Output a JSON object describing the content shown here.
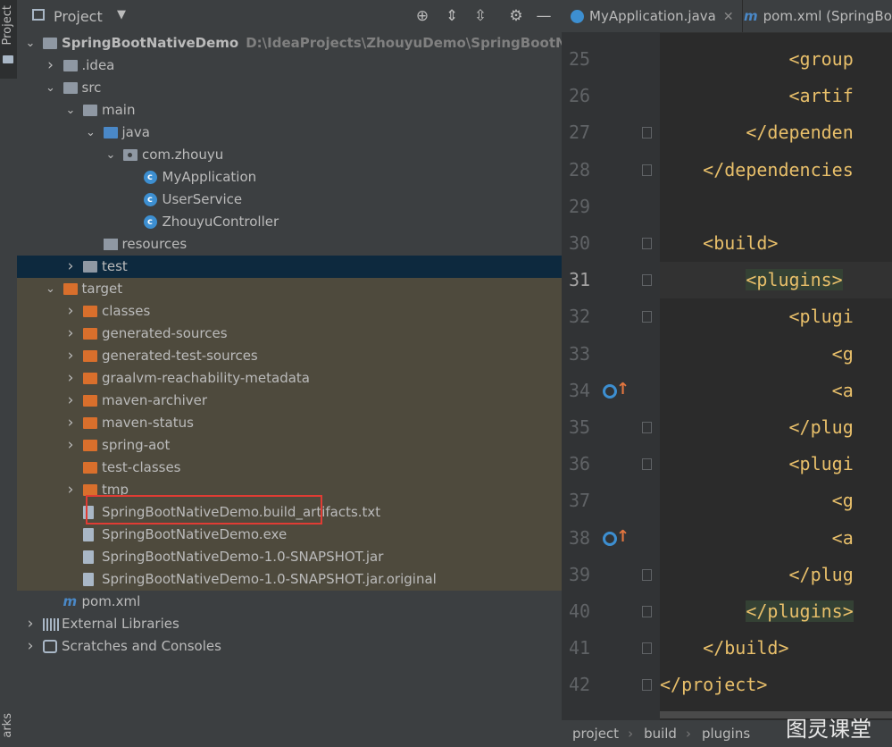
{
  "side_strip": {
    "project_label": "Project",
    "bookmarks_label": "arks"
  },
  "panel": {
    "title": "Project",
    "dropdown_icon": "triangle-down",
    "tools": [
      "locate-icon",
      "expand-all-icon",
      "collapse-all-icon",
      "gear-icon",
      "minimize-icon"
    ]
  },
  "tree": [
    {
      "label": "SpringBootNativeDemo",
      "path": "D:\\IdeaProjects\\ZhouyuDemo\\SpringBootNativeDe",
      "icon": "module-folder",
      "level": 0,
      "arrow": "down",
      "bold": true
    },
    {
      "label": ".idea",
      "icon": "folder-gray",
      "level": 1,
      "arrow": "right"
    },
    {
      "label": "src",
      "icon": "folder-gray",
      "level": 1,
      "arrow": "down"
    },
    {
      "label": "main",
      "icon": "folder-gray",
      "level": 2,
      "arrow": "down"
    },
    {
      "label": "java",
      "icon": "folder-blue",
      "level": 3,
      "arrow": "down"
    },
    {
      "label": "com.zhouyu",
      "icon": "package",
      "level": 4,
      "arrow": "down"
    },
    {
      "label": "MyApplication",
      "icon": "class-spring",
      "level": 5,
      "arrow": ""
    },
    {
      "label": "UserService",
      "icon": "class",
      "level": 5,
      "arrow": ""
    },
    {
      "label": "ZhouyuController",
      "icon": "class",
      "level": 5,
      "arrow": ""
    },
    {
      "label": "resources",
      "icon": "resources-folder",
      "level": 3,
      "arrow": ""
    },
    {
      "label": "test",
      "icon": "folder-gray",
      "level": 2,
      "arrow": "right",
      "selected": true
    },
    {
      "label": "target",
      "icon": "folder-orange",
      "level": 1,
      "arrow": "down",
      "excluded": true
    },
    {
      "label": "classes",
      "icon": "folder-orange",
      "level": 2,
      "arrow": "right",
      "excluded": true
    },
    {
      "label": "generated-sources",
      "icon": "folder-orange",
      "level": 2,
      "arrow": "right",
      "excluded": true
    },
    {
      "label": "generated-test-sources",
      "icon": "folder-orange",
      "level": 2,
      "arrow": "right",
      "excluded": true
    },
    {
      "label": "graalvm-reachability-metadata",
      "icon": "folder-orange",
      "level": 2,
      "arrow": "right",
      "excluded": true
    },
    {
      "label": "maven-archiver",
      "icon": "folder-orange",
      "level": 2,
      "arrow": "right",
      "excluded": true
    },
    {
      "label": "maven-status",
      "icon": "folder-orange",
      "level": 2,
      "arrow": "right",
      "excluded": true
    },
    {
      "label": "spring-aot",
      "icon": "folder-orange",
      "level": 2,
      "arrow": "right",
      "excluded": true
    },
    {
      "label": "test-classes",
      "icon": "folder-orange",
      "level": 2,
      "arrow": "",
      "excluded": true
    },
    {
      "label": "tmp",
      "icon": "folder-orange",
      "level": 2,
      "arrow": "right",
      "excluded": true
    },
    {
      "label": "SpringBootNativeDemo.build_artifacts.txt",
      "icon": "text-file",
      "level": 2,
      "arrow": "",
      "excluded": true
    },
    {
      "label": "SpringBootNativeDemo.exe",
      "icon": "unknown-file",
      "level": 2,
      "arrow": "",
      "excluded": true,
      "highlighted": true
    },
    {
      "label": "SpringBootNativeDemo-1.0-SNAPSHOT.jar",
      "icon": "jar-file",
      "level": 2,
      "arrow": "",
      "excluded": true
    },
    {
      "label": "SpringBootNativeDemo-1.0-SNAPSHOT.jar.original",
      "icon": "unknown-file",
      "level": 2,
      "arrow": "",
      "excluded": true
    },
    {
      "label": "pom.xml",
      "icon": "maven-file",
      "level": 1,
      "arrow": ""
    },
    {
      "label": "External Libraries",
      "icon": "libraries",
      "level": 0,
      "arrow": "right"
    },
    {
      "label": "Scratches and Consoles",
      "icon": "scratches",
      "level": 0,
      "arrow": "right"
    }
  ],
  "editor": {
    "tabs": [
      {
        "label": "MyApplication.java",
        "icon": "class-spring-icon",
        "closable": true
      },
      {
        "label": "pom.xml (SpringBo",
        "icon": "maven-icon"
      }
    ],
    "current_line": "31",
    "lines": [
      {
        "num": "25",
        "text": "            <group"
      },
      {
        "num": "26",
        "text": "            <artif"
      },
      {
        "num": "27",
        "text": "        </dependen",
        "fold": true
      },
      {
        "num": "28",
        "text": "    </dependencies",
        "fold": true
      },
      {
        "num": "29",
        "text": ""
      },
      {
        "num": "30",
        "text": "    <build>",
        "fold": true
      },
      {
        "num": "31",
        "text": "        <plugins>",
        "fold": true,
        "current": true,
        "hl": "<plugins>"
      },
      {
        "num": "32",
        "text": "            <plugi",
        "fold": true
      },
      {
        "num": "33",
        "text": "                <g"
      },
      {
        "num": "34",
        "text": "                <a",
        "marker": true
      },
      {
        "num": "35",
        "text": "            </plug",
        "fold": true
      },
      {
        "num": "36",
        "text": "            <plugi",
        "fold": true
      },
      {
        "num": "37",
        "text": "                <g"
      },
      {
        "num": "38",
        "text": "                <a",
        "marker": true
      },
      {
        "num": "39",
        "text": "            </plug",
        "fold": true
      },
      {
        "num": "40",
        "text": "        </plugins>",
        "fold": true,
        "hl": "</plugins>"
      },
      {
        "num": "41",
        "text": "    </build>",
        "fold": true
      },
      {
        "num": "42",
        "text": "</project>",
        "fold": true
      }
    ],
    "breadcrumb": [
      "project",
      "build",
      "plugins"
    ]
  },
  "watermark": "图灵课堂",
  "colors": {
    "selection": "#0d293e",
    "excluded_bg": "#4e4a3d",
    "highlight_box": "#e03c34",
    "xml_tag": "#e8bf6a",
    "folder_orange": "#d96f2c",
    "folder_blue": "#4a88c7"
  }
}
